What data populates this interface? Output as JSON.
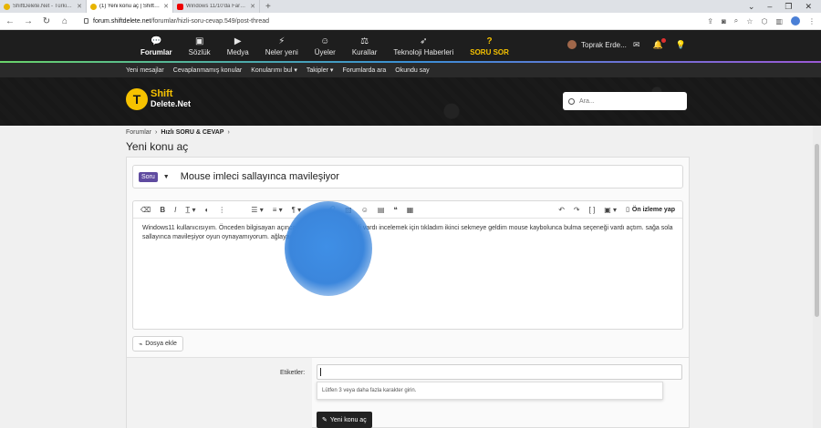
{
  "browser": {
    "tabs": [
      {
        "title": "ShiftDelete.Net - Türkiye'n...",
        "active": false
      },
      {
        "title": "(1) Yeni konu aç | ShiftDel...",
        "active": true
      },
      {
        "title": "Windows 11/10'da Fare a...",
        "active": false
      }
    ],
    "url_domain": "forum.shiftdelete.net",
    "url_path": "/forumlar/hizli-soru-cevap.549/post-thread"
  },
  "nav": {
    "items": [
      {
        "label": "Forumlar",
        "icon": "chat-bubbles-icon"
      },
      {
        "label": "Sözlük",
        "icon": "dictionary-icon"
      },
      {
        "label": "Medya",
        "icon": "video-icon"
      },
      {
        "label": "Neler yeni",
        "icon": "bolt-icon"
      },
      {
        "label": "Üyeler",
        "icon": "users-icon"
      },
      {
        "label": "Kurallar",
        "icon": "scales-icon"
      },
      {
        "label": "Teknoloji Haberleri",
        "icon": "rocket-icon"
      },
      {
        "label": "SORU SOR",
        "icon": "question-icon"
      }
    ],
    "username": "Toprak Erde..."
  },
  "subnav": [
    "Yeni mesajlar",
    "Cevaplanmamış konular",
    "Konularımı bul ▾",
    "Takipler ▾",
    "Forumlarda ara",
    "Okundu say"
  ],
  "logo": {
    "line1": "Shift",
    "line2": "Delete.Net"
  },
  "search": {
    "placeholder": "Ara..."
  },
  "breadcrumb": {
    "root": "Forumlar",
    "current": "Hızlı SORU & CEVAP"
  },
  "page_title": "Yeni konu aç",
  "form": {
    "prefix": "Soru",
    "thread_title": "Mouse imleci sallayınca mavileşiyor",
    "preview_label": "Ön izleme yap",
    "body_text": "Windows11 kullanıcısıyım. Önceden bilgisayarı açınca sol üstte kontrol paneli vardı incelemek için tıkladım ikinci sekmeye geldim mouse kaybolunca bulma seçeneği vardı açtım. sağa sola sallayınca mavileşiyor oyun oynayamıyorum. ağlayacağım nolur yardım edin",
    "attach_label": "Dosya ekle",
    "tags_label": "Etiketler:",
    "tags_hint": "Lütfen 3 veya daha fazla karakter girin.",
    "submit_label": "Yeni konu aç"
  }
}
